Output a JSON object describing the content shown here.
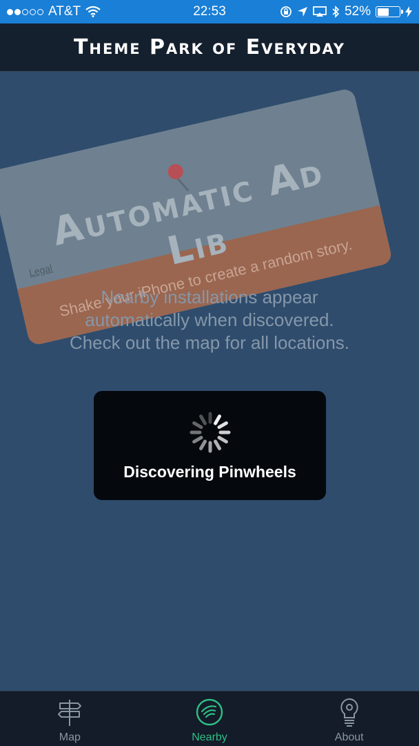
{
  "status_bar": {
    "carrier": "AT&T",
    "time": "22:53",
    "battery": "52%",
    "battery_level": 0.52,
    "signal_filled": 2,
    "signal_total": 5
  },
  "nav": {
    "title": "Theme Park of Everyday"
  },
  "ad_card": {
    "title": "Automatic Ad Lib",
    "legal_link": "Legal",
    "tagline": "Shake your iPhone to create a random story."
  },
  "empty_state": {
    "line1": "Nearby installations appear",
    "line2": "automatically when discovered.",
    "line3": "Check out the map for all locations."
  },
  "hud": {
    "label": "Discovering Pinwheels"
  },
  "tabs": [
    {
      "label": "Map",
      "icon": "signpost-icon",
      "active": false
    },
    {
      "label": "Nearby",
      "icon": "radar-icon",
      "active": true
    },
    {
      "label": "About",
      "icon": "lightbulb-icon",
      "active": false
    }
  ],
  "colors": {
    "accent": "#2fbf85",
    "status_bar": "#1a7fd6",
    "background": "#2f4c6d"
  }
}
